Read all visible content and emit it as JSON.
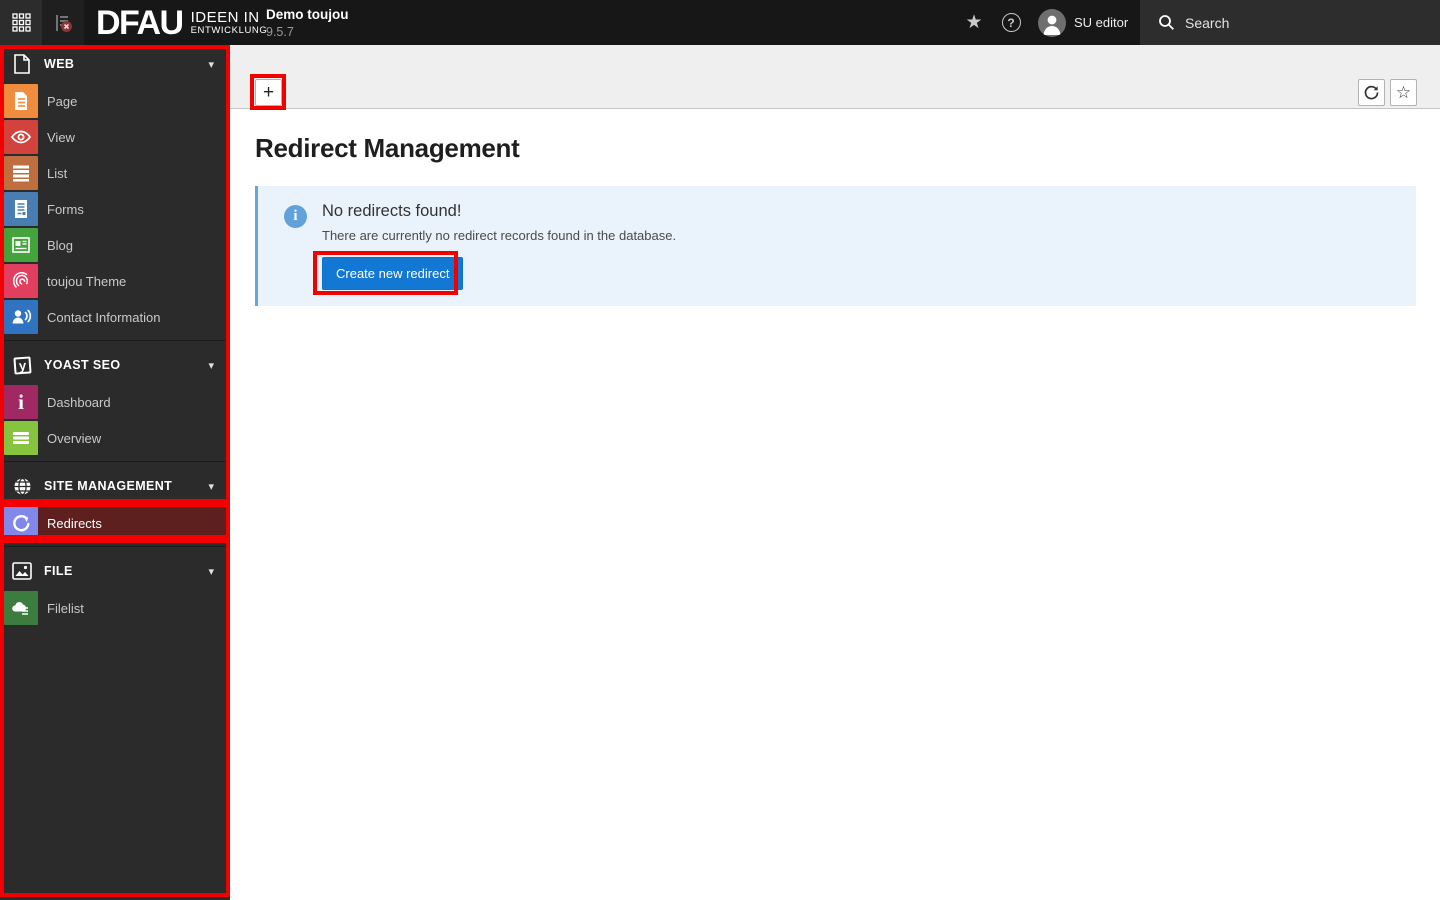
{
  "topbar": {
    "logo": "DFAU",
    "tagline_line1": "IDEEN IN",
    "tagline_line2": "ENTWICKLUNG",
    "site_name": "Demo toujou",
    "version": "9.5.7",
    "user_name": "SU editor",
    "search_label": "Search"
  },
  "sidebar": {
    "sections": [
      {
        "label": "WEB",
        "items": [
          {
            "label": "Page"
          },
          {
            "label": "View"
          },
          {
            "label": "List"
          },
          {
            "label": "Forms"
          },
          {
            "label": "Blog"
          },
          {
            "label": "toujou Theme"
          },
          {
            "label": "Contact Information"
          }
        ]
      },
      {
        "label": "YOAST SEO",
        "items": [
          {
            "label": "Dashboard"
          },
          {
            "label": "Overview"
          }
        ]
      },
      {
        "label": "SITE MANAGEMENT",
        "items": [
          {
            "label": "Redirects",
            "active": true
          }
        ]
      },
      {
        "label": "FILE",
        "items": [
          {
            "label": "Filelist"
          }
        ]
      }
    ]
  },
  "docheader": {
    "add_label": "+",
    "bookmark_label": "☆"
  },
  "main": {
    "title": "Redirect Management",
    "infobox": {
      "icon_glyph": "i",
      "title": "No redirects found!",
      "message": "There are currently no redirect records found in the database.",
      "button_label": "Create new redirect"
    }
  },
  "icons": {
    "caret": "▾",
    "star_filled": "★",
    "help_glyph": "?",
    "yoast_glyph": "y",
    "dashboard_glyph": "i"
  },
  "colors": {
    "topbar_bg": "#171717",
    "sidebar_bg": "#2b2b2b",
    "active_item_bg": "#5e1f1f",
    "annotation_red": "#f20000",
    "docheader_bg": "#efefef",
    "infobox_bg": "#eaf3fb",
    "infobox_border": "#6aa5da",
    "info_icon_bg": "#61a2da",
    "primary_button_bg": "#1377d4",
    "tile_page": "#ef8c3d",
    "tile_view": "#d2433e",
    "tile_list": "#bf6e3f",
    "tile_forms": "#4a7eb3",
    "tile_blog": "#44a33c",
    "tile_theme": "#e23e5f",
    "tile_contact": "#3073c0",
    "tile_dashboard": "#a02963",
    "tile_overview": "#86c440",
    "tile_redirects": "#8287ea",
    "tile_filelist": "#3d7c3f"
  }
}
